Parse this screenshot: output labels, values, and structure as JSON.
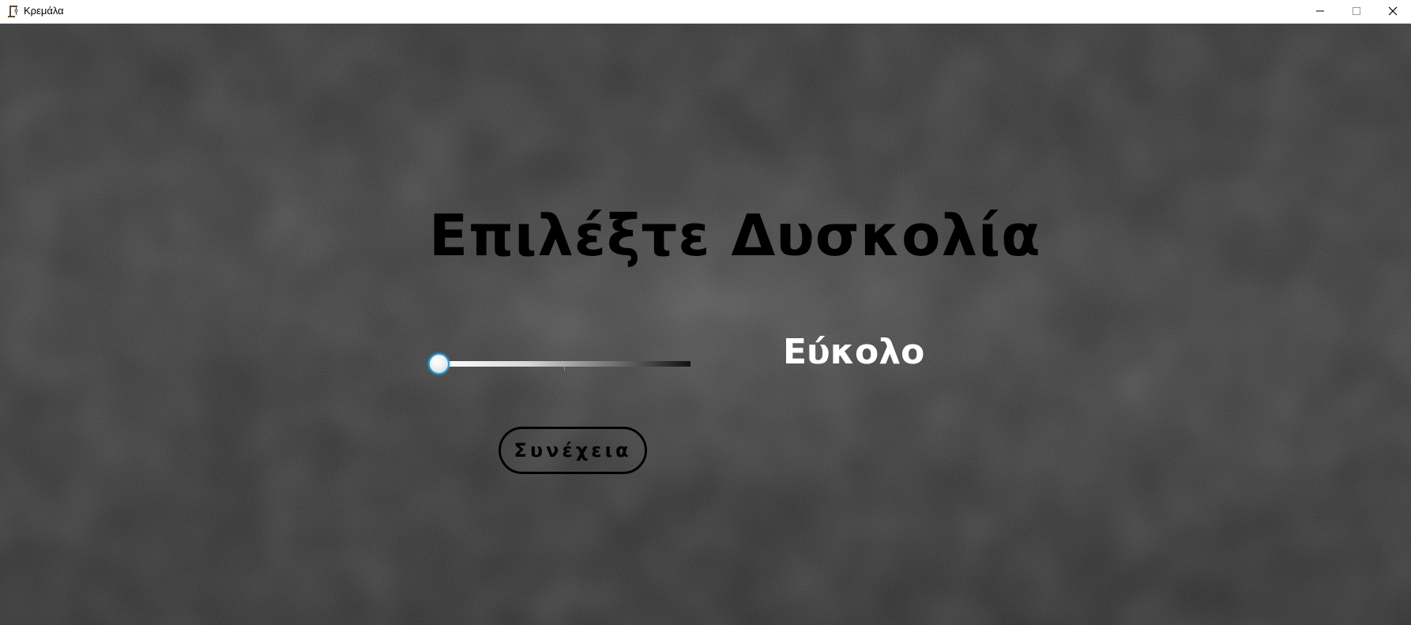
{
  "window": {
    "title": "Κρεμάλα",
    "controls": {
      "minimize": "minimize-icon",
      "maximize": "maximize-icon",
      "close": "close-icon"
    }
  },
  "main": {
    "heading": "Επιλέξτε Δυσκολία",
    "difficulty_slider": {
      "value": 0,
      "min": 0,
      "max": 2
    },
    "difficulty_label": "Εύκολο",
    "continue_label": "Συνέχεια"
  },
  "colors": {
    "heading": "#000000",
    "difficulty_label": "#ffffff",
    "slider_thumb_border": "#2a9fd6",
    "button_border": "#000000",
    "titlebar": "#ffffff"
  }
}
